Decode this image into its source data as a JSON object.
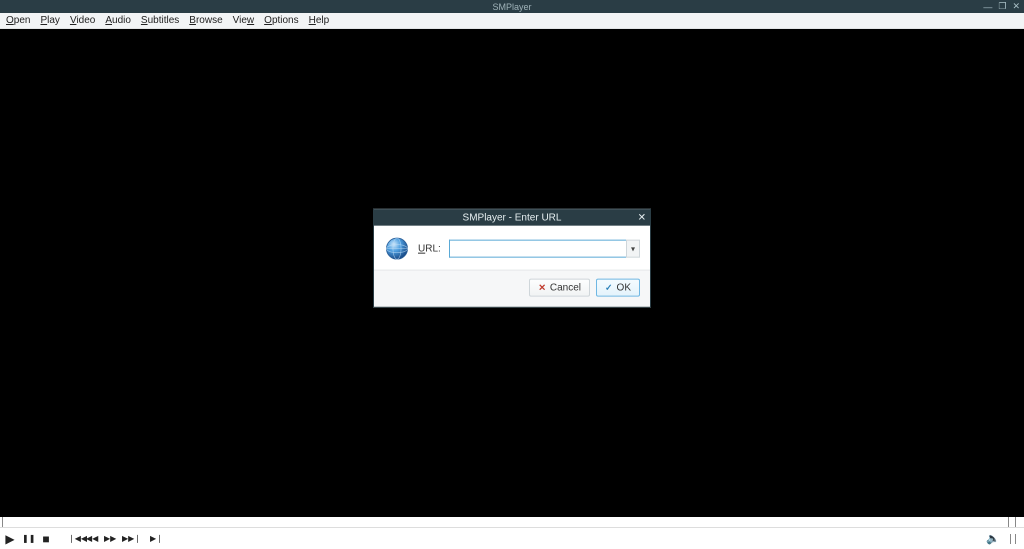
{
  "titlebar": {
    "title": "SMPlayer"
  },
  "menubar": {
    "items": [
      {
        "label": "Open",
        "underline_index": 0
      },
      {
        "label": "Play",
        "underline_index": 0
      },
      {
        "label": "Video",
        "underline_index": 0
      },
      {
        "label": "Audio",
        "underline_index": 0
      },
      {
        "label": "Subtitles",
        "underline_index": 0
      },
      {
        "label": "Browse",
        "underline_index": 0
      },
      {
        "label": "View",
        "underline_index": 3
      },
      {
        "label": "Options",
        "underline_index": 0
      },
      {
        "label": "Help",
        "underline_index": 0
      }
    ]
  },
  "dialog": {
    "title": "SMPlayer - Enter URL",
    "url_label": "URL:",
    "url_underline_index": 0,
    "url_value": "",
    "cancel_label": "Cancel",
    "ok_label": "OK"
  },
  "controls": {
    "play": "▶",
    "pause": "❚❚",
    "stop": "■",
    "prev_rewind": "❘◀◀",
    "rewind": "◀◀",
    "forward": "▶▶",
    "next_forward": "▶▶❘",
    "step": "▶❘"
  }
}
